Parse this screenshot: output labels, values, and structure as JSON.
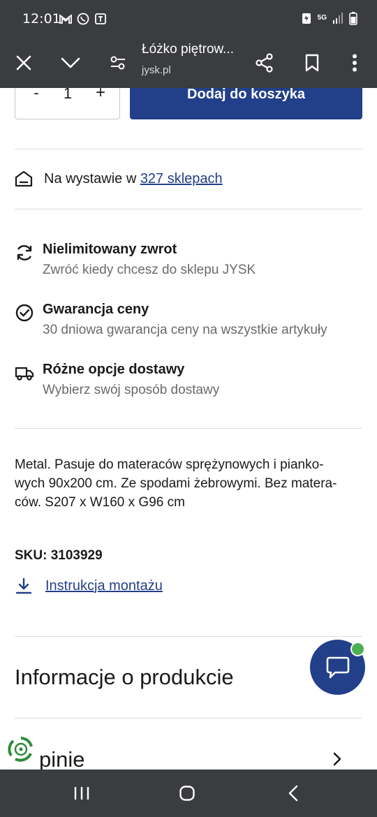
{
  "status_bar": {
    "time": "12:01",
    "network": "5G",
    "icons": [
      "gmail-icon",
      "whatsapp-icon",
      "app-icon",
      "battery-saver-icon",
      "signal-icon",
      "battery-icon"
    ]
  },
  "browser": {
    "page_title": "Łóżko piętrow...",
    "domain": "jysk.pl",
    "icons": [
      "close-icon",
      "chevron-down-icon",
      "tune-icon",
      "share-icon",
      "bookmark-icon",
      "more-icon"
    ]
  },
  "purchase": {
    "minus": "-",
    "quantity": "1",
    "plus": "+",
    "add_to_cart": "Dodaj do koszyka"
  },
  "stock": {
    "prefix": "Na wystawie w ",
    "link": "327 sklepach"
  },
  "features": [
    {
      "title": "Nielimitowany zwrot",
      "subtitle": "Zwróć kiedy chcesz do sklepu JYSK",
      "icon": "refresh-icon"
    },
    {
      "title": "Gwarancja ceny",
      "subtitle": "30 dniowa gwarancja ceny na wszystkie artykuły",
      "icon": "check-circle-icon"
    },
    {
      "title": "Różne opcje dostawy",
      "subtitle": "Wybierz swój sposób dostawy",
      "icon": "truck-icon"
    }
  ],
  "product": {
    "description_lines": [
      "Metal. Pasuje do materaców sprężynowych i pianko-",
      "wych 90x200 cm. Ze spodami żebrowymi. Bez matera-",
      "ców. S207 x W160 x G96 cm"
    ],
    "sku": "SKU: 3103929",
    "manual_link": "Instrukcja montażu"
  },
  "sections": {
    "info": "Informacje o produkcie",
    "opinions": "pinie"
  },
  "colors": {
    "brand_blue": "#223f8a",
    "system_bar": "#3b3c40",
    "online_green": "#4caf50"
  }
}
